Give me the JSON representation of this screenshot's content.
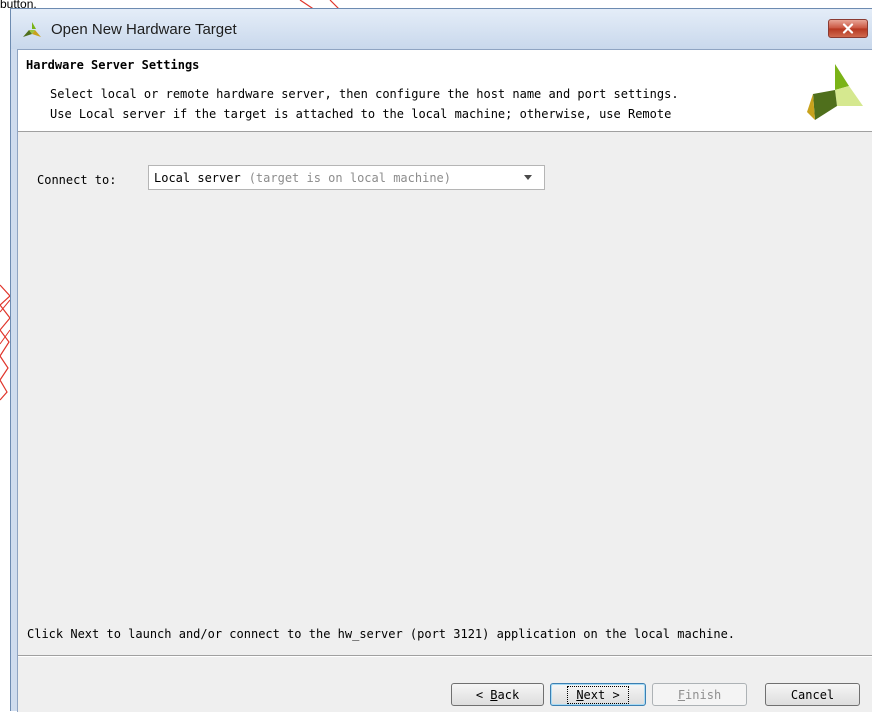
{
  "top_fragment": "button.",
  "window": {
    "title": "Open New Hardware Target",
    "close_symbol": "✕"
  },
  "header": {
    "title": "Hardware Server Settings",
    "line1": "Select local or remote hardware server, then configure the host name and port settings.",
    "line2": "Use Local server if the target is attached to the local machine; otherwise, use Remote",
    "logo": "xilinx-logo"
  },
  "connect": {
    "label": "Connect to:",
    "selected_main": "Local server",
    "selected_hint": "(target is on local machine)"
  },
  "info_text": "Click Next to launch and/or connect to the hw_server (port 3121) application on the local machine.",
  "buttons": {
    "back_prefix": "< ",
    "back_mnemonic": "B",
    "back_rest": "ack",
    "next_mnemonic": "N",
    "next_rest": "ext >",
    "finish_mnemonic": "F",
    "finish_rest": "inish",
    "cancel": "Cancel"
  },
  "colors": {
    "titlebar": "#cfdcee",
    "client": "#efefef",
    "logo_green": "#7ab317",
    "logo_dark": "#4f6f1c",
    "logo_light": "#d5e88f"
  }
}
